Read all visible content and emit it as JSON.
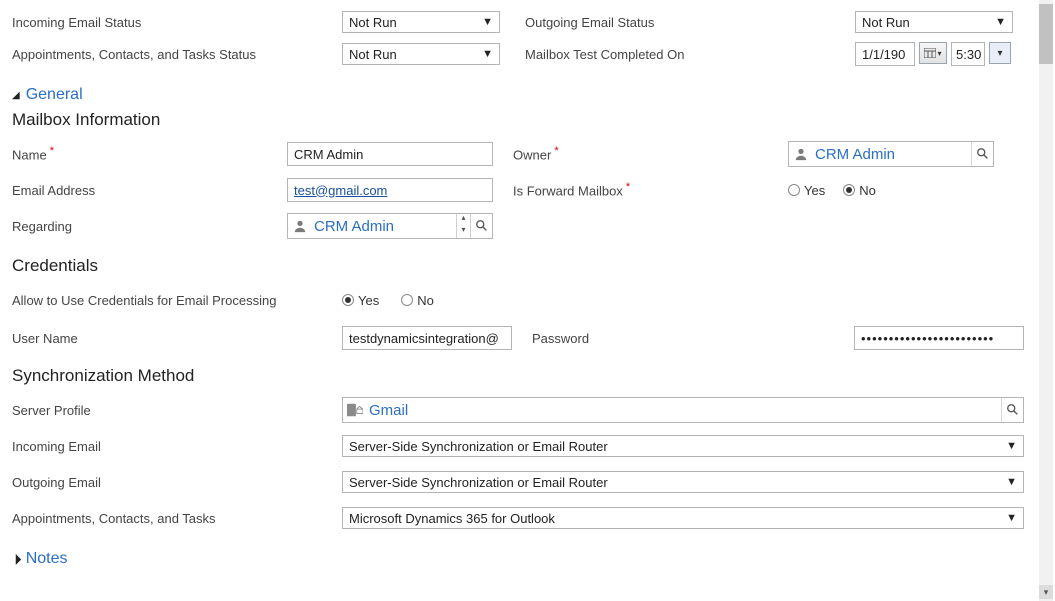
{
  "top": {
    "incoming_email_status_label": "Incoming Email Status",
    "incoming_email_status_value": "Not Run",
    "outgoing_email_status_label": "Outgoing Email Status",
    "outgoing_email_status_value": "Not Run",
    "act_label": "Appointments, Contacts, and Tasks Status",
    "act_value": "Not Run",
    "test_completed_label": "Mailbox Test Completed On",
    "test_completed_date": "1/1/190",
    "test_completed_time": "5:30"
  },
  "sections": {
    "general": "General",
    "mailbox_info": "Mailbox Information",
    "credentials": "Credentials",
    "sync_method": "Synchronization Method",
    "notes": "Notes"
  },
  "mailbox": {
    "name_label": "Name",
    "name_value": "CRM Admin",
    "owner_label": "Owner",
    "owner_value": "CRM Admin",
    "email_label": "Email Address",
    "email_value": "test@gmail.com",
    "isforward_label": "Is Forward Mailbox",
    "yes": "Yes",
    "no": "No",
    "isforward_selected": "No",
    "regarding_label": "Regarding",
    "regarding_value": "CRM Admin"
  },
  "credentials": {
    "allow_label": "Allow to Use Credentials for Email Processing",
    "allow_selected": "Yes",
    "yes": "Yes",
    "no": "No",
    "username_label": "User Name",
    "username_value": "testdynamicsintegration@",
    "password_label": "Password",
    "password_value": "••••••••••••••••••••••••"
  },
  "sync": {
    "server_profile_label": "Server Profile",
    "server_profile_value": "Gmail",
    "incoming_label": "Incoming Email",
    "incoming_value": "Server-Side Synchronization or Email Router",
    "outgoing_label": "Outgoing Email",
    "outgoing_value": "Server-Side Synchronization or Email Router",
    "act_label": "Appointments, Contacts, and Tasks",
    "act_value": "Microsoft Dynamics 365 for Outlook"
  }
}
